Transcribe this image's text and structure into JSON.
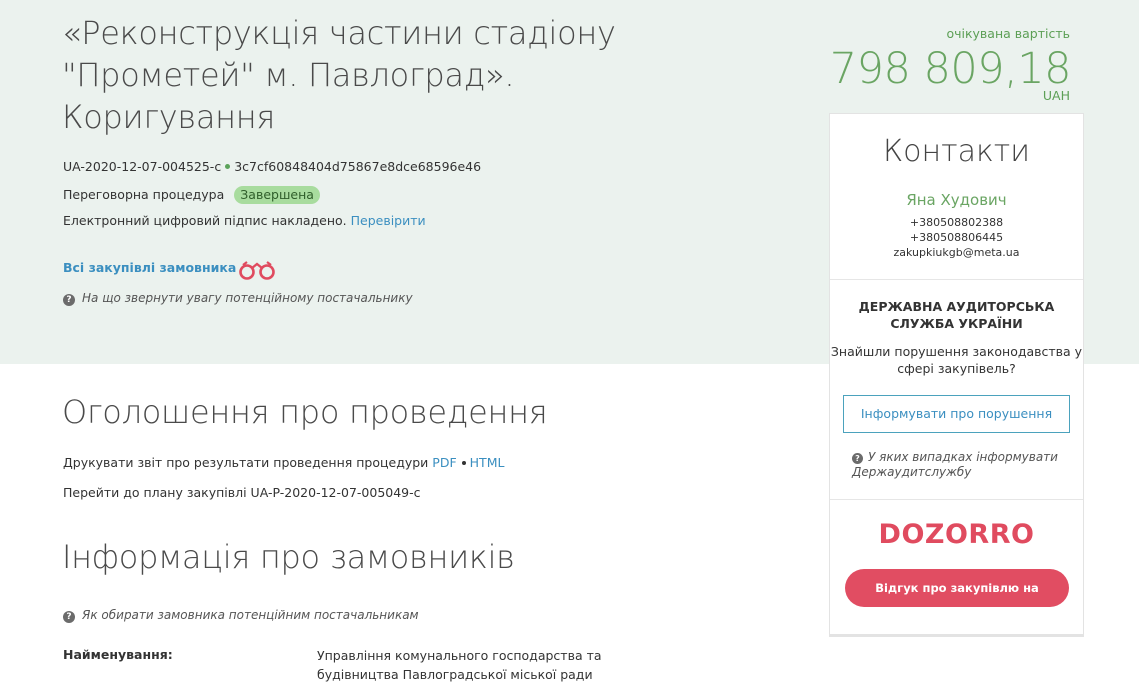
{
  "tender": {
    "title": "«Реконструкція частини стадіону \"Прометей\" м. Павлоград». Коригування",
    "id": "UA-2020-12-07-004525-c",
    "hash": "3c7cf60848404d75867e8dce68596e46",
    "procedure": "Переговорна процедура",
    "status": "Завершена",
    "signature_text": "Електронний цифровий підпис накладено.",
    "signature_link": "Перевірити",
    "all_purchases_link": "Всі закупівлі замовника",
    "supplier_hint": "На що звернути увагу потенційному постачальнику"
  },
  "price": {
    "caption": "очікувана вартість",
    "value": "798 809,18",
    "currency": "UAH"
  },
  "contacts": {
    "title": "Контакти",
    "name": "Яна Худович",
    "phone1": "+380508802388",
    "phone2": "+380508806445",
    "email": "zakupkiukgb@meta.ua"
  },
  "audit": {
    "title": "ДЕРЖАВНА АУДИТОРСЬКА СЛУЖБА УКРАЇНИ",
    "text": "Знайшли порушення законодавства у сфері закупівель?",
    "button": "Інформувати про порушення",
    "hint": "У яких випадках інформувати Держаудитслужбу"
  },
  "dozorro": {
    "logo": "DOZORRO",
    "button": "Відгук про закупівлю на Дозорро"
  },
  "announcement": {
    "title": "Оголошення про проведення",
    "print_text": "Друкувати звіт про результати проведення процедури",
    "pdf": "PDF",
    "html": "HTML",
    "plan_link": "Перейти до плану закупівлі UA-P-2020-12-07-005049-c"
  },
  "customers": {
    "title": "Інформація про замовників",
    "hint": "Як обирати замовника потенційним постачальникам",
    "name_label": "Найменування:",
    "name_value": "Управління комунального господарства та будівництва Павлоградської міської ради"
  },
  "colors": {
    "hero_bg": "#ebf2ee",
    "accent_green": "#6aa563",
    "link_blue": "#3b8fc0",
    "dozorro_red": "#e14d62"
  }
}
